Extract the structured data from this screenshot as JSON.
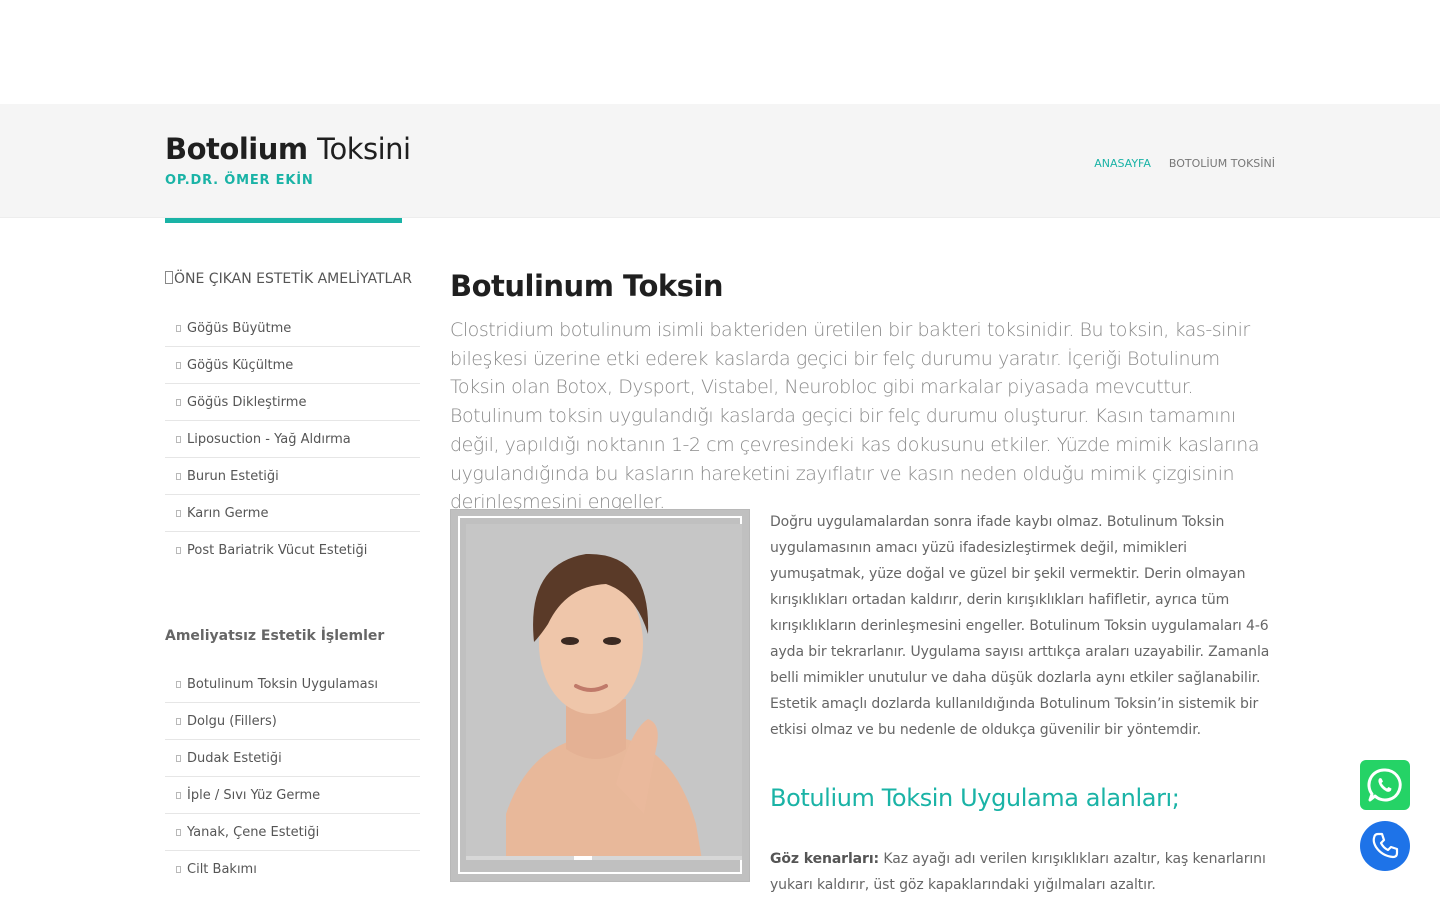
{
  "header": {
    "title_bold": "Botolium",
    "title_light": "Toksini",
    "subtitle": "OP.DR. ÖMER EKİN"
  },
  "breadcrumb": {
    "home": "ANASAYFA",
    "separator": "",
    "current": "BOTOLİUM TOKSİNİ"
  },
  "sidebar": {
    "section1_icon": "",
    "section1_title": "ÖNE ÇIKAN ESTETİK AMELİYATLAR",
    "section1_items": [
      "Göğüs Büyütme",
      "Göğüs Küçültme",
      "Göğüs Dikleştirme",
      "Liposuction - Yağ Aldırma",
      "Burun Estetiği",
      "Karın Germe",
      "Post Bariatrik Vücut Estetiği"
    ],
    "section2_title": "Ameliyatsız Estetik İşlemler",
    "section2_items": [
      "Botulinum Toksin Uygulaması",
      "Dolgu (Fillers)",
      "Dudak Estetiği",
      "İple / Sıvı Yüz Germe",
      "Yanak, Çene Estetiği",
      "Cilt Bakımı"
    ]
  },
  "main": {
    "title_bold": "Botulinum",
    "title_light": "Toksin",
    "lead": "Clostridium botulinum isimli bakteriden üretilen bir bakteri toksinidir. Bu toksin, kas-sinir bileşkesi üzerine etki ederek kaslarda geçici bir felç durumu yaratır. İçeriği Botulinum Toksin olan Botox, Dysport, Vistabel, Neurobloc gibi markalar piyasada mevcuttur. Botulinum toksin uygulandığı kaslarda geçici bir felç durumu oluşturur. Kasın tamamını değil, yapıldığı noktanın 1-2 cm çevresindeki kas dokusunu etkiler. Yüzde mimik kaslarına uygulandığında bu kasların hareketini zayıflatır ve kasın neden olduğu mimik çizgisinin derinleşmesini engeller.",
    "body": "Doğru uygulamalardan sonra ifade kaybı olmaz. Botulinum Toksin uygulamasının amacı yüzü ifadesizleştirmek değil, mimikleri yumuşatmak, yüze doğal ve güzel bir şekil vermektir. Derin olmayan kırışıklıkları ortadan kaldırır, derin kırışıklıkları hafifletir, ayrıca tüm kırışıklıkların derinleşmesini engeller. Botulinum Toksin uygulamaları 4-6 ayda bir tekrarlanır. Uygulama sayısı arttıkça araları uzayabilir. Zamanla belli mimikler unutulur ve daha düşük dozlarla aynı etkiler sağlanabilir. Estetik amaçlı dozlarda kullanıldığında Botulinum Toksin’in sistemik bir etkisi olmaz ve bu nedenle de oldukça güvenilir bir yöntemdir.",
    "section_heading": "Botulium Toksin Uygulama alanları;",
    "item1_label": "Göz kenarları:",
    "item1_text": " Kaz ayağı adı verilen kırışıklıkları azaltır, kaş kenarlarını yukarı kaldırır, üst göz kapaklarındaki yığılmaları azaltır."
  },
  "icons": {
    "whatsapp": "whatsapp-icon",
    "phone": "phone-icon"
  },
  "colors": {
    "accent": "#1ab3a6",
    "whatsapp": "#25d366",
    "phone": "#1e73e8"
  }
}
